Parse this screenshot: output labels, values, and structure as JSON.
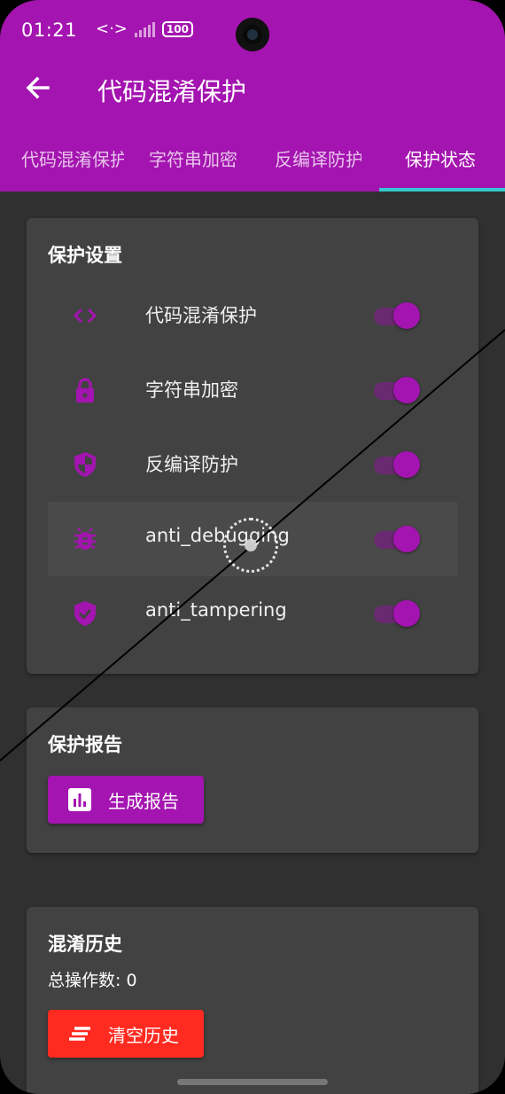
{
  "status_bar": {
    "time": "01:21",
    "signal_glyph": "<·>",
    "battery": "100"
  },
  "app_bar": {
    "title": "代码混淆保护",
    "back_icon": "arrow-left-icon"
  },
  "tabs": [
    {
      "label": "代码混淆保护",
      "active": false
    },
    {
      "label": "字符串加密",
      "active": false
    },
    {
      "label": "反编译防护",
      "active": false
    },
    {
      "label": "保护状态",
      "active": true
    }
  ],
  "protection_settings": {
    "title": "保护设置",
    "items": [
      {
        "label": "代码混淆保护",
        "icon": "code-icon",
        "enabled": true
      },
      {
        "label": "字符串加密",
        "icon": "lock-icon",
        "enabled": true
      },
      {
        "label": "反编译防护",
        "icon": "shield-icon",
        "enabled": true
      },
      {
        "label": "anti_debugging",
        "icon": "bug-icon",
        "enabled": true
      },
      {
        "label": "anti_tampering",
        "icon": "verified-shield-icon",
        "enabled": true
      }
    ]
  },
  "protection_report": {
    "title": "保护报告",
    "generate_button": "生成报告",
    "button_icon": "bar-chart-icon"
  },
  "history": {
    "title": "混淆历史",
    "count_text": "总操作数: 0",
    "clear_button": "清空历史",
    "button_icon": "clear-all-icon"
  },
  "colors": {
    "primary": "#a414b0",
    "tab_indicator": "#36c9d1",
    "danger": "#ff2a20",
    "background": "#303030",
    "card": "#424242"
  }
}
